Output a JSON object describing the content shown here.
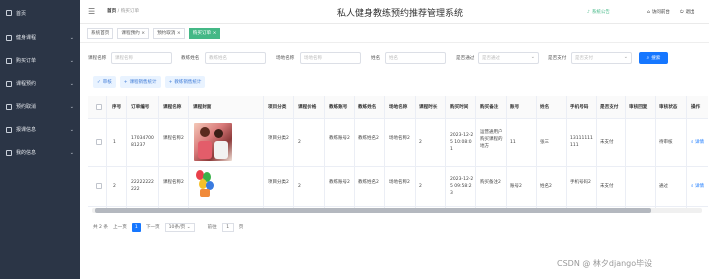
{
  "sidebar": {
    "items": [
      {
        "label": "首页",
        "icon": "home-icon"
      },
      {
        "label": "健身课程",
        "icon": "dumbbell-icon"
      },
      {
        "label": "购买订单",
        "icon": "order-icon"
      },
      {
        "label": "课程预约",
        "icon": "calendar-icon"
      },
      {
        "label": "预约取消",
        "icon": "cancel-icon"
      },
      {
        "label": "报课信息",
        "icon": "info-icon"
      },
      {
        "label": "我的信息",
        "icon": "user-icon"
      }
    ]
  },
  "header": {
    "breadcrumb_home": "首页",
    "breadcrumb_current": "购买订单",
    "title": "私人健身教练预约推荐管理系统",
    "actions": [
      {
        "label": "系统公告",
        "icon": "bell-icon",
        "color": "#44b886"
      },
      {
        "label": "访问前台",
        "icon": "home-icon",
        "color": "#333333"
      },
      {
        "label": "退出",
        "icon": "logout-icon",
        "color": "#333333"
      }
    ]
  },
  "tabs": [
    {
      "label": "系统首页",
      "active": false
    },
    {
      "label": "课程预约 ×",
      "active": false
    },
    {
      "label": "预约取消 ×",
      "active": false
    },
    {
      "label": "购买订单 ×",
      "active": true
    }
  ],
  "filters": {
    "fields": [
      {
        "label": "课程名称",
        "placeholder": "课程名称"
      },
      {
        "label": "教练姓名",
        "placeholder": "教练姓名"
      },
      {
        "label": "场地名称",
        "placeholder": "场地名称"
      },
      {
        "label": "姓名",
        "placeholder": "姓名"
      },
      {
        "label": "是否通过",
        "placeholder": "是否通过"
      },
      {
        "label": "是否支付",
        "placeholder": "是否支付"
      }
    ],
    "search_label": "搜索"
  },
  "actions": {
    "audit": "审核",
    "stat1": "课程销售统计",
    "stat2": "教练销售统计"
  },
  "table": {
    "columns": [
      "序号",
      "订单编号",
      "课程名称",
      "课程封面",
      "项目分类",
      "课程价格",
      "教练账号",
      "教练姓名",
      "场地名称",
      "课程时长",
      "购买时间",
      "购买备注",
      "账号",
      "姓名",
      "手机号码",
      "是否支付",
      "审核回复",
      "审核状态",
      "操作"
    ],
    "rows": [
      {
        "index": "1",
        "order_no": "1703470081237",
        "course": "课程名称2",
        "category": "项目分类2",
        "price": "2",
        "coach_account": "教练账号2",
        "coach_name": "教练姓名2",
        "venue": "场地名称2",
        "duration": "2",
        "time": "2023-12-25 10:08:01",
        "remark": "运营通用户购买课程的地方",
        "account": "11",
        "name": "张三",
        "phone": "13111111111",
        "paid": "未支付",
        "reply": "",
        "status": "待审核",
        "op": "详情"
      },
      {
        "index": "2",
        "order_no": "22222222222",
        "course": "课程名称2",
        "category": "项目分类2",
        "price": "2",
        "coach_account": "教练账号2",
        "coach_name": "教练姓名2",
        "venue": "场地名称2",
        "duration": "2",
        "time": "2023-12-25 09:58:23",
        "remark": "购买备注2",
        "account": "账号2",
        "name": "姓名2",
        "phone": "手机号码2",
        "paid": "未支付",
        "reply": "",
        "status": "通过",
        "op": "详情"
      }
    ]
  },
  "pager": {
    "total": "共 2 条",
    "prev": "上一页",
    "page": "1",
    "next": "下一页",
    "size": "10条/页",
    "goto": "前往",
    "goto_val": "1",
    "page_unit": "页"
  },
  "watermark": "CSDN @ 林夕django毕设"
}
